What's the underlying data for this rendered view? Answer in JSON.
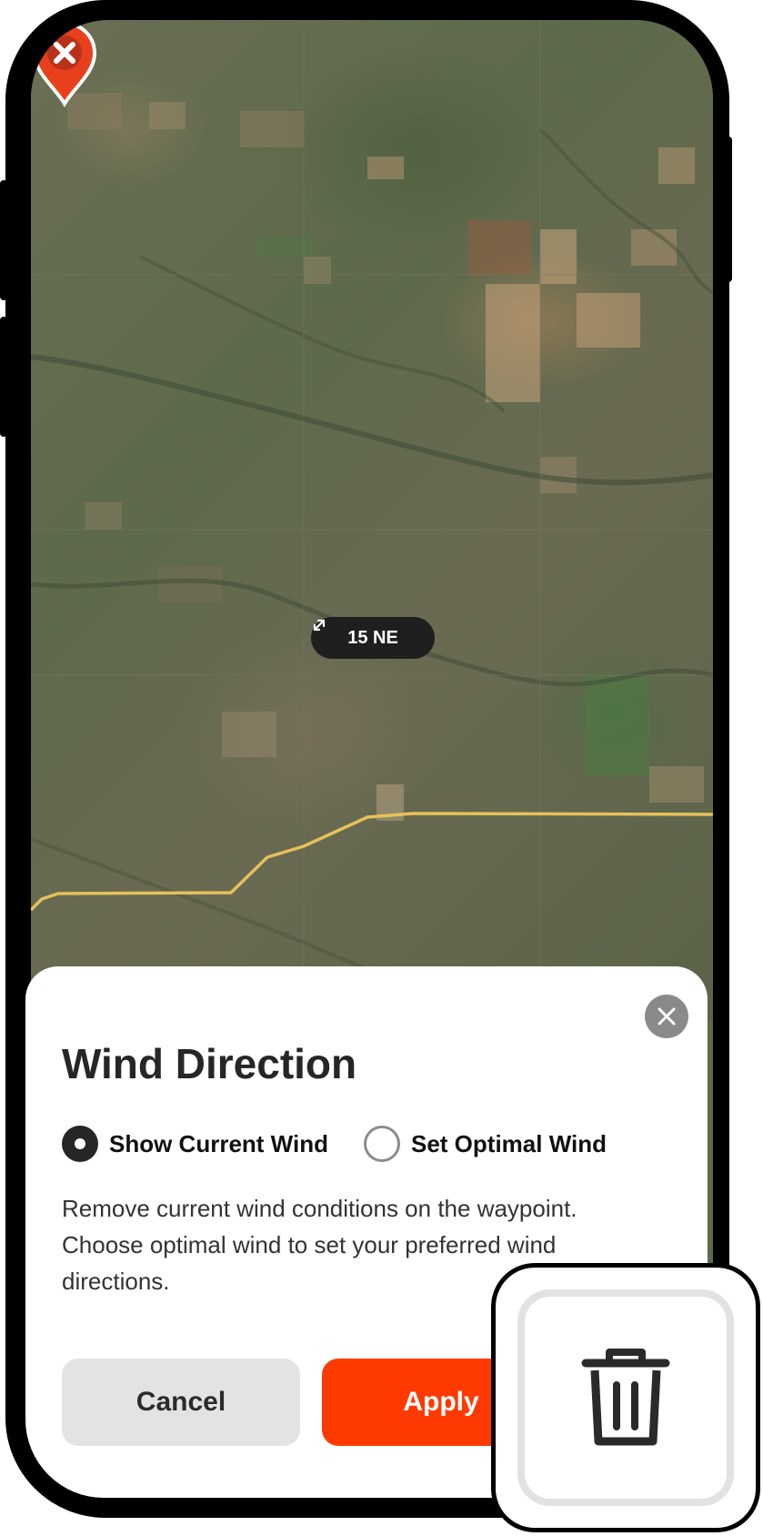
{
  "map": {
    "wind_chip": {
      "icon": "wind-direction-arrow-icon",
      "label": "15 NE"
    },
    "waypoint_pin": {
      "icon": "close-marker-icon",
      "color": "#e8401c"
    },
    "road_color": "#e6c15a"
  },
  "sheet": {
    "title": "Wind Direction",
    "close_icon": "close-icon",
    "options": [
      {
        "label": "Show Current Wind",
        "selected": true
      },
      {
        "label": "Set Optimal Wind",
        "selected": false
      }
    ],
    "description": "Remove current wind conditions on the waypoint. Choose optimal wind to set your preferred wind directions.",
    "cancel_label": "Cancel",
    "apply_label": "Apply",
    "accent_color": "#ff3a00"
  },
  "callout": {
    "icon": "trash-icon"
  }
}
